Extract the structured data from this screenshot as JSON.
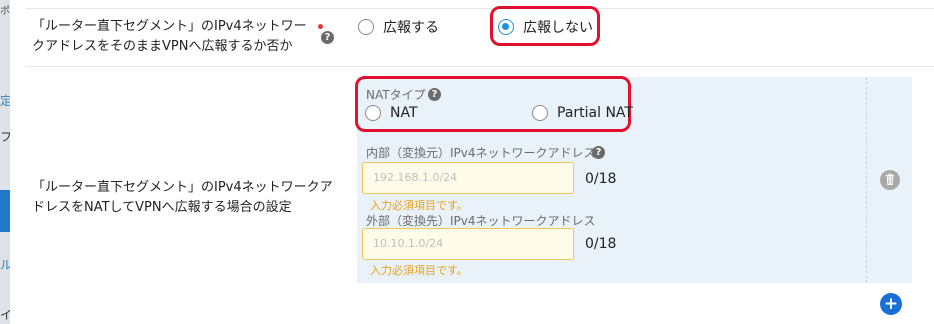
{
  "background": {
    "fragments": [
      "ポ",
      "定",
      "フ",
      "ル",
      "イ"
    ]
  },
  "row1": {
    "label_line1": "「ルーター直下セグメント」のIPv4ネットワー",
    "label_line2": "クアドレスをそのままVPNへ広報するか否か",
    "required_mark": "•",
    "help_icon": "?",
    "option_yes": "広報する",
    "option_no": "広報しない",
    "selected": "広報しない"
  },
  "row2": {
    "label_line1": "「ルーター直下セグメント」のIPv4ネットワークア",
    "label_line2": "ドレスをNATしてVPNへ広報する場合の設定",
    "nat_type_label": "NATタイプ",
    "nat_help_icon": "?",
    "nat_option_nat": "NAT",
    "nat_option_partial": "Partial NAT",
    "internal_label": "内部（変換元）IPv4ネットワークアドレス",
    "internal_help_icon": "?",
    "internal_placeholder": "192.168.1.0/24",
    "internal_counter": "0/18",
    "internal_error": "入力必須項目です。",
    "external_label": "外部（変換先）IPv4ネットワークアドレス",
    "external_placeholder": "10.10.1.0/24",
    "external_counter": "0/18",
    "external_error": "入力必須項目です。"
  },
  "actions": {
    "delete_icon": "trash-icon",
    "add_icon": "+"
  },
  "colors": {
    "accent": "#1a8fe3",
    "highlight": "#e0102e",
    "panel_bg": "#e9f1f9",
    "warning": "#e8a317"
  }
}
